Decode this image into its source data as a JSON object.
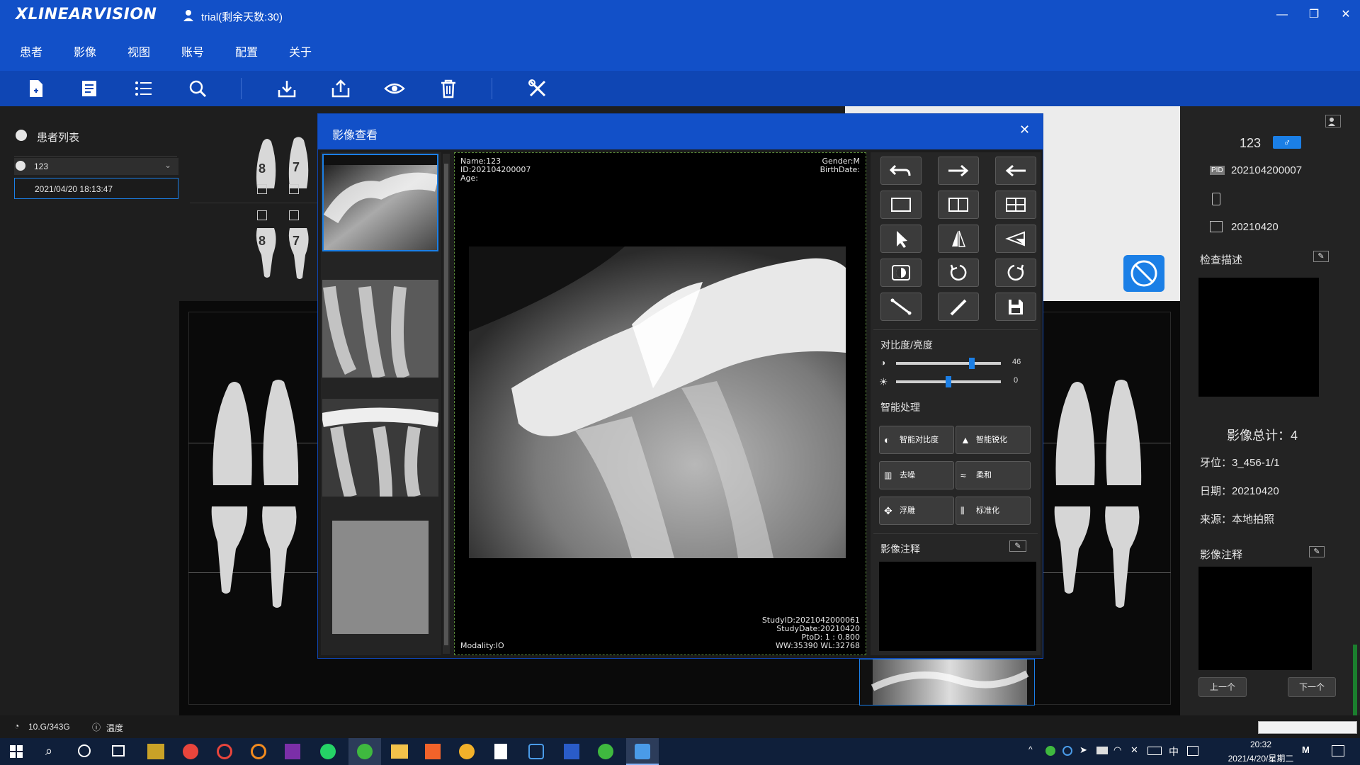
{
  "app": {
    "logo": "XLINEARVISION",
    "user": "trial(剩余天数:30)"
  },
  "window_controls": {
    "minimize": "—",
    "restore": "❐",
    "close": "✕"
  },
  "menu": [
    "患者",
    "影像",
    "视图",
    "账号",
    "配置",
    "关于"
  ],
  "toolbar": [
    "new-patient-icon",
    "edit-icon",
    "list-icon",
    "search-icon",
    "import-icon",
    "export-icon",
    "view-icon",
    "delete-icon",
    "tools-icon"
  ],
  "patient_list": {
    "header": "患者列表",
    "patient": "123",
    "study_datetime": "2021/04/20 18:13:47"
  },
  "tooth_strip": {
    "upper": [
      "8",
      "7"
    ],
    "lower": [
      "8",
      "7"
    ]
  },
  "dialog": {
    "title": "影像查看",
    "overlay": {
      "name": "Name:123",
      "id": "ID:202104200007",
      "age": "Age:",
      "gender": "Gender:M",
      "birthdate": "BirthDate:",
      "modality": "Modality:IO",
      "study_id": "StudyID:2021042000061",
      "study_date": "StudyDate:20210420",
      "ptod": "PtoD: 1 : 0.800",
      "ww_wl": "WW:35390   WL:32768"
    },
    "contrast_brightness": {
      "label": "对比度/亮度",
      "contrast": 46,
      "brightness": 0,
      "contrast_text": "46",
      "brightness_text": "0",
      "contrast_fraction": 0.72,
      "brightness_fraction": 0.5
    },
    "smart_label": "智能处理",
    "smart_buttons": [
      "智能对比度",
      "智能锐化",
      "去噪",
      "柔和",
      "浮雕",
      "标准化"
    ],
    "annotation_label": "影像注释"
  },
  "right_panel": {
    "patient": "123",
    "pid_label": "PID",
    "pid": "202104200007",
    "date": "20210420",
    "exam_desc_label": "检查描述",
    "image_total": "影像总计：4",
    "tooth_pos": "牙位：3_456-1/1",
    "date_line": "日期：20210420",
    "source": "来源：本地拍照",
    "annotation_label": "影像注释",
    "prev": "上一个",
    "next": "下一个"
  },
  "statusbar": {
    "disk": "10.G/343G",
    "temp": "温度"
  },
  "taskbar": {
    "time": "20:32",
    "date": "2021/4/20/星期二",
    "ime": "中"
  },
  "colors": {
    "titlebar": "#1250c8",
    "toolbar": "#0f46b4",
    "accent": "#1b7fe6"
  }
}
